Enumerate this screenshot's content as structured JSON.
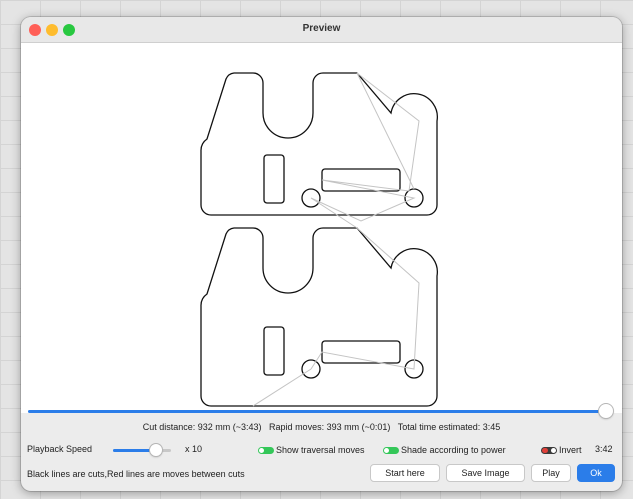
{
  "window": {
    "title": "Preview"
  },
  "stats": {
    "cut_distance": "Cut distance: 932 mm (~3:43)",
    "rapid_moves": "Rapid moves: 393 mm (~0:01)",
    "total_time": "Total time estimated: 3:45"
  },
  "progress": {
    "fraction": 1.0
  },
  "controls": {
    "playback_label": "Playback Speed",
    "speed_multiplier": "x 10",
    "speed_fraction": 0.7,
    "show_traversal": {
      "label": "Show traversal moves",
      "on": true
    },
    "shade_power": {
      "label": "Shade according to power",
      "on": true
    },
    "invert": {
      "label": "Invert",
      "on": false
    },
    "time_readout": "3:42"
  },
  "footer": {
    "hint": "Black lines are cuts,Red lines are moves between cuts",
    "start_here": "Start here",
    "save_image": "Save Image",
    "play": "Play",
    "ok": "Ok"
  },
  "colors": {
    "accent": "#2b7de9",
    "switch_on": "#34c759",
    "cut": "#111111",
    "traversal": "#bbbbbb"
  }
}
